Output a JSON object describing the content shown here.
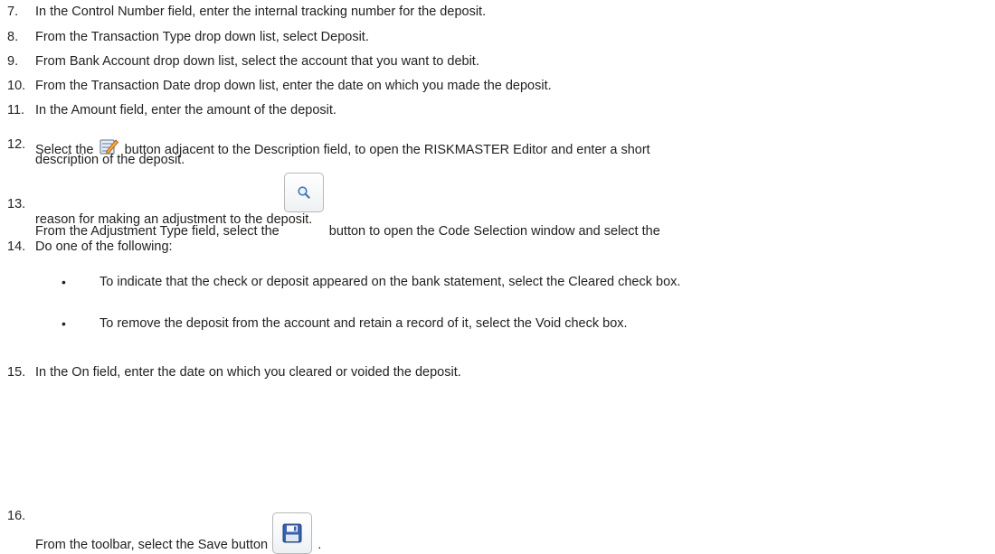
{
  "steps": [
    {
      "num": "7.",
      "text": "In the Control Number field, enter the internal tracking number for the deposit."
    },
    {
      "num": "8.",
      "text": "From the Transaction Type drop down list, select Deposit."
    },
    {
      "num": "9.",
      "text": "From Bank Account drop down list, select the account that you want to debit."
    },
    {
      "num": "10.",
      "text": "From the Transaction Date drop down list, enter the date on which you made the deposit."
    },
    {
      "num": "11.",
      "text": "In the Amount field, enter the amount of the deposit."
    },
    {
      "num": "12.",
      "text_before": "Select the",
      "text_after": "button adjacent to the Description field, to open the RISKMASTER Editor and enter a short",
      "text_line2": "description of the deposit.",
      "icon": "edit-icon"
    },
    {
      "num": "13.",
      "text_before": "From the Adjustment Type field, select the",
      "text_after": "button  to open the Code Selection window and select the",
      "text_line2": "reason for making an adjustment to the deposit.",
      "icon": "search-icon"
    },
    {
      "num": "14.",
      "text": "Do one of the following:"
    },
    {
      "num": "15.",
      "text": "In the On field, enter the date on which you cleared or voided the deposit."
    },
    {
      "num": "16.",
      "text_before": "From the toolbar, select the Save button",
      "text_after": ".",
      "icon": "save-icon"
    }
  ],
  "bullets": [
    {
      "symbol": "•",
      "text": "To indicate that the check or deposit appeared on the bank statement, select the Cleared check box."
    },
    {
      "symbol": "•",
      "text": "To remove the deposit from the account and retain a record of it, select the Void check box."
    }
  ]
}
